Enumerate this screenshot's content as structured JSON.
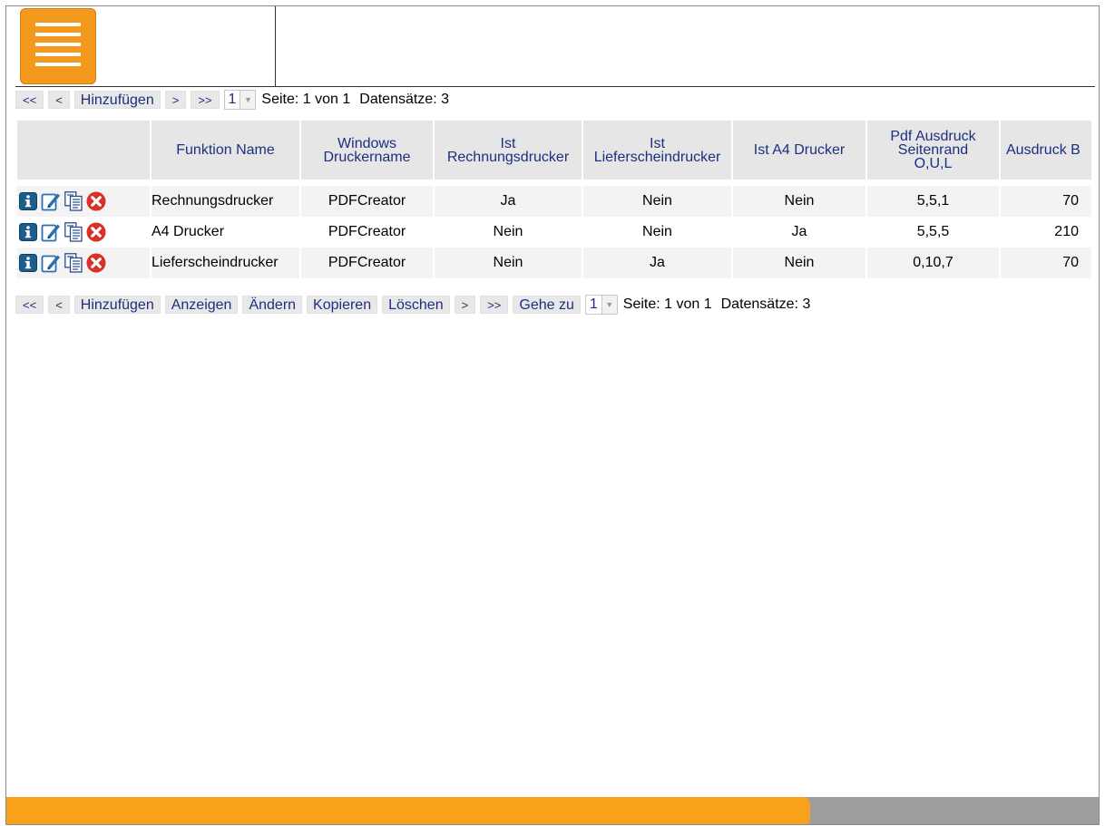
{
  "top_pager": {
    "first": "<<",
    "prev": "<",
    "add": "Hinzufügen",
    "next": ">",
    "last": ">>",
    "page_select": "1",
    "page_info": "Seite: 1 von 1",
    "records_info": "Datensätze: 3"
  },
  "bottom_pager": {
    "first": "<<",
    "prev": "<",
    "add": "Hinzufügen",
    "show": "Anzeigen",
    "edit": "Ändern",
    "copy": "Kopieren",
    "delete": "Löschen",
    "next": ">",
    "last": ">>",
    "goto": "Gehe zu",
    "page_select": "1",
    "page_info": "Seite: 1 von 1",
    "records_info": "Datensätze: 3"
  },
  "table": {
    "headers": [
      {
        "line1": "Funktion Name",
        "line2": "",
        "line3": ""
      },
      {
        "line1": "Windows",
        "line2": "Druckername",
        "line3": ""
      },
      {
        "line1": "Ist",
        "line2": "Rechnungsdrucker",
        "line3": ""
      },
      {
        "line1": "Ist",
        "line2": "Lieferscheindrucker",
        "line3": ""
      },
      {
        "line1": "Ist A4 Drucker",
        "line2": "",
        "line3": ""
      },
      {
        "line1": "Pdf Ausdruck",
        "line2": "Seitenrand",
        "line3": "O,U,L"
      },
      {
        "line1": "Ausdruck B",
        "line2": "",
        "line3": ""
      }
    ],
    "rows": [
      {
        "name": "Rechnungsdrucker",
        "printer": "PDFCreator",
        "invoice": "Ja",
        "delivery": "Nein",
        "a4": "Nein",
        "margin": "5,5,1",
        "width": "70"
      },
      {
        "name": "A4 Drucker",
        "printer": "PDFCreator",
        "invoice": "Nein",
        "delivery": "Nein",
        "a4": "Ja",
        "margin": "5,5,5",
        "width": "210"
      },
      {
        "name": "Lieferscheindrucker",
        "printer": "PDFCreator",
        "invoice": "Nein",
        "delivery": "Ja",
        "a4": "Nein",
        "margin": "0,10,7",
        "width": "70"
      }
    ]
  },
  "icons": {
    "menu": "hamburger-menu-icon",
    "info": "info-icon",
    "edit": "edit-icon",
    "copy": "copy-icon",
    "delete": "delete-icon"
  },
  "colors": {
    "accent": "#f39a1e",
    "link": "#1c2f80",
    "header_bg": "#e6e6e6",
    "info_icon": "#1b5e8c",
    "delete_icon": "#d9302c",
    "scrollbar_track": "#9e9e9e"
  },
  "scrollbar": {
    "visible_fraction": 0.735
  }
}
